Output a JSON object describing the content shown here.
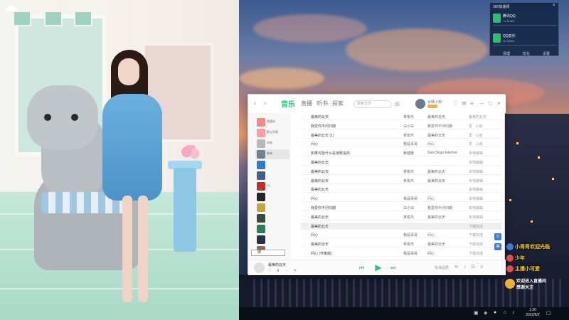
{
  "music": {
    "tabs": [
      "音乐",
      "直播",
      "听书",
      "探索"
    ],
    "search_placeholder": "搜索音乐",
    "username": "云晴小玥",
    "sidebar": [
      {
        "label": "我喜欢",
        "color": "#f08b8b"
      },
      {
        "label": "默认列表",
        "color": "#ff9ca2"
      },
      {
        "label": "本地",
        "color": "#b8b8b8"
      },
      {
        "label": "歌单",
        "color": "#708090"
      },
      {
        "label": "",
        "color": "#2f79c8"
      },
      {
        "label": "",
        "color": "#465e87"
      },
      {
        "label": "DJ",
        "color": "#b8302a"
      },
      {
        "label": "",
        "color": "#1f2630"
      },
      {
        "label": "",
        "color": "#c6a53e"
      },
      {
        "label": "",
        "color": "#3b4b39"
      },
      {
        "label": "",
        "color": "#2e7d55"
      },
      {
        "label": "",
        "color": "#26313d"
      },
      {
        "label": "",
        "color": "#8b6b52"
      }
    ],
    "side_search": "搜",
    "rows": [
      {
        "song": "最美的云天",
        "artist": "林俊杰",
        "album": "最美的云天",
        "dur": "最美的云天"
      },
      {
        "song": "我爱你不问归期",
        "artist": "白小白",
        "album": "我爱你不问归期",
        "dur": "爱 · 心动"
      },
      {
        "song": "最美的云天 (1)",
        "artist": "林俊杰",
        "album": "最美的云天",
        "dur": "爱 · 心动"
      },
      {
        "song": "问心",
        "artist": "我是哥哥",
        "album": "问心",
        "dur": "爱 · 心动"
      },
      {
        "song": "如果可能什么是道数是的",
        "artist": "蔡健雅",
        "album": "San Diego Internet",
        "dur": "本地歌曲"
      },
      {
        "song": "最美的云天",
        "artist": "",
        "album": "",
        "dur": "本地歌曲"
      },
      {
        "song": "最美的云天",
        "artist": "林俊杰",
        "album": "最美的云天",
        "dur": "本地歌曲"
      },
      {
        "song": "最美的云天",
        "artist": "林俊杰",
        "album": "最美的云天",
        "dur": "本地歌曲"
      },
      {
        "song": "最美的云天",
        "artist": "",
        "album": "",
        "dur": "本地歌曲"
      },
      {
        "song": "问心",
        "artist": "我是哥哥",
        "album": "问心",
        "dur": "本地歌曲"
      },
      {
        "song": "我爱你不问归期",
        "artist": "白小白",
        "album": "我爱你不问归期",
        "dur": "本地歌曲"
      },
      {
        "song": "最美的云天",
        "artist": "林俊杰",
        "album": "最美的云天",
        "dur": "本地歌曲"
      },
      {
        "song": "最美的云天",
        "artist": "",
        "album": "",
        "dur": "下载完成"
      },
      {
        "song": "问心",
        "artist": "我是哥哥",
        "album": "问心",
        "dur": "下载完成"
      },
      {
        "song": "最美的云天",
        "artist": "林俊杰",
        "album": "最美的云天",
        "dur": "下载完成"
      },
      {
        "song": "问心 (伴奏版)",
        "artist": "我是哥哥",
        "album": "问心",
        "dur": "下载完成"
      }
    ],
    "now_playing": "最美的云天",
    "quality_label": "标准品质"
  },
  "security": {
    "title": "360加速球",
    "items": [
      {
        "name": "腾讯QQ",
        "size": "14.81MB"
      },
      {
        "name": "QQ音乐",
        "size": "20.48MB"
      }
    ],
    "footer": [
      "清理",
      "优化",
      "设置"
    ]
  },
  "chat": [
    {
      "name": "小哥哥",
      "text": "欢迎光临",
      "badge_color": "#3d7bd8"
    },
    {
      "name": "少年",
      "text": "",
      "badge_color": "#e64c4c"
    },
    {
      "name": "主播",
      "text": "小可爱",
      "badge_color": "#e64c4c"
    }
  ],
  "welcome": {
    "line1": "欢迎进入直播间",
    "line2": "感谢关注"
  },
  "taskbar": {
    "time": "1:30",
    "date": "2022/6/2"
  },
  "colors": {
    "accent": "#31c27c",
    "chat": "#ffd21f"
  }
}
